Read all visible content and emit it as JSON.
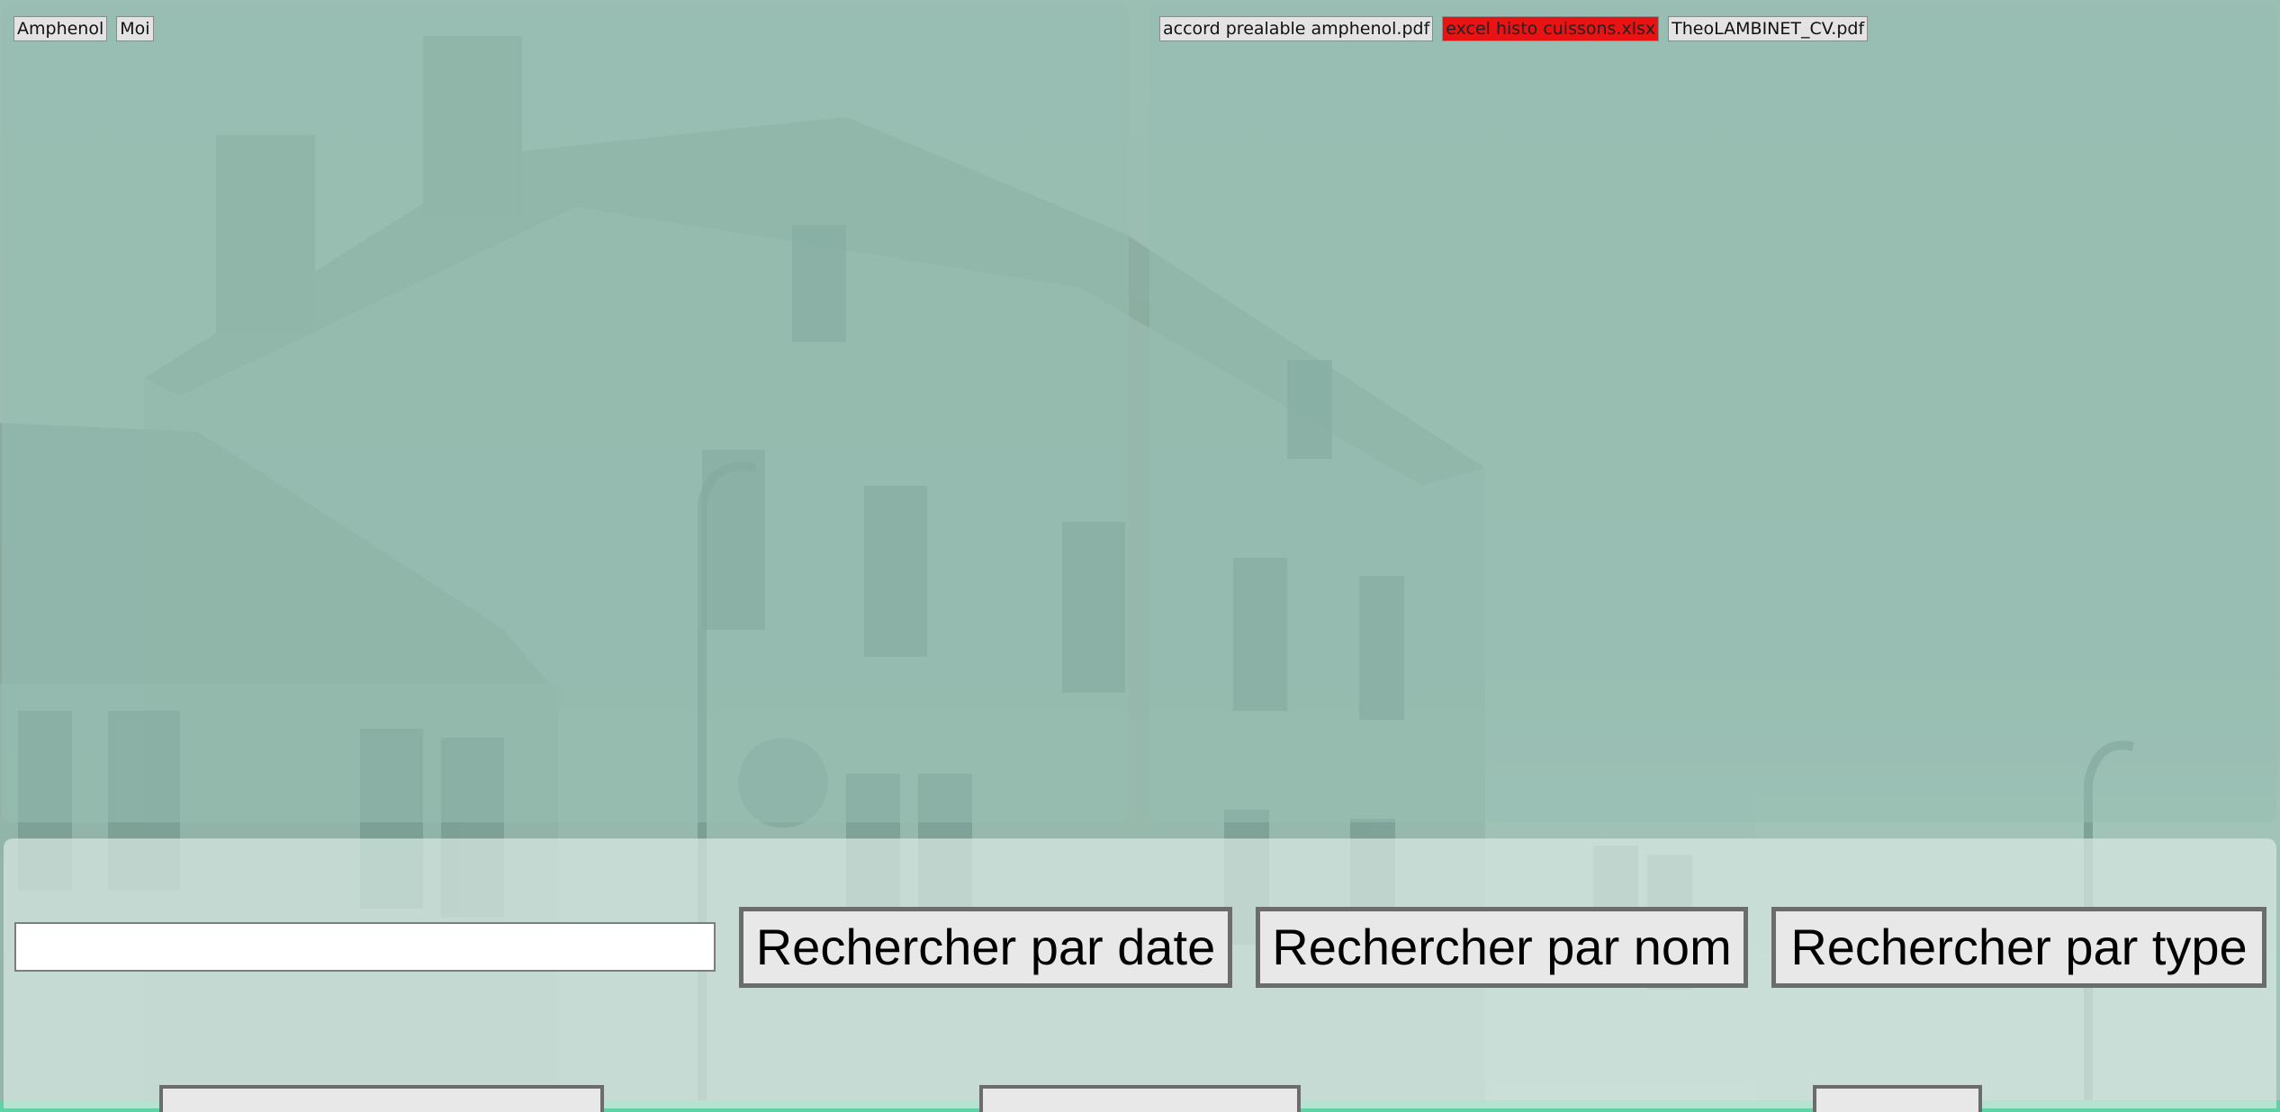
{
  "folders": [
    {
      "label": "Amphenol"
    },
    {
      "label": "Moi"
    }
  ],
  "files": [
    {
      "label": "accord prealable amphenol.pdf",
      "active": false
    },
    {
      "label": "excel histo cuissons.xlsx",
      "active": true
    },
    {
      "label": "TheoLAMBINET_CV.pdf",
      "active": false
    }
  ],
  "search": {
    "value": "",
    "placeholder": ""
  },
  "buttons": {
    "by_date": "Rechercher par date",
    "by_name": "Rechercher par nom",
    "by_type": "Rechercher par type"
  },
  "colors": {
    "accent_green": "#5fd2a6",
    "active_tab": "#ea1313"
  }
}
